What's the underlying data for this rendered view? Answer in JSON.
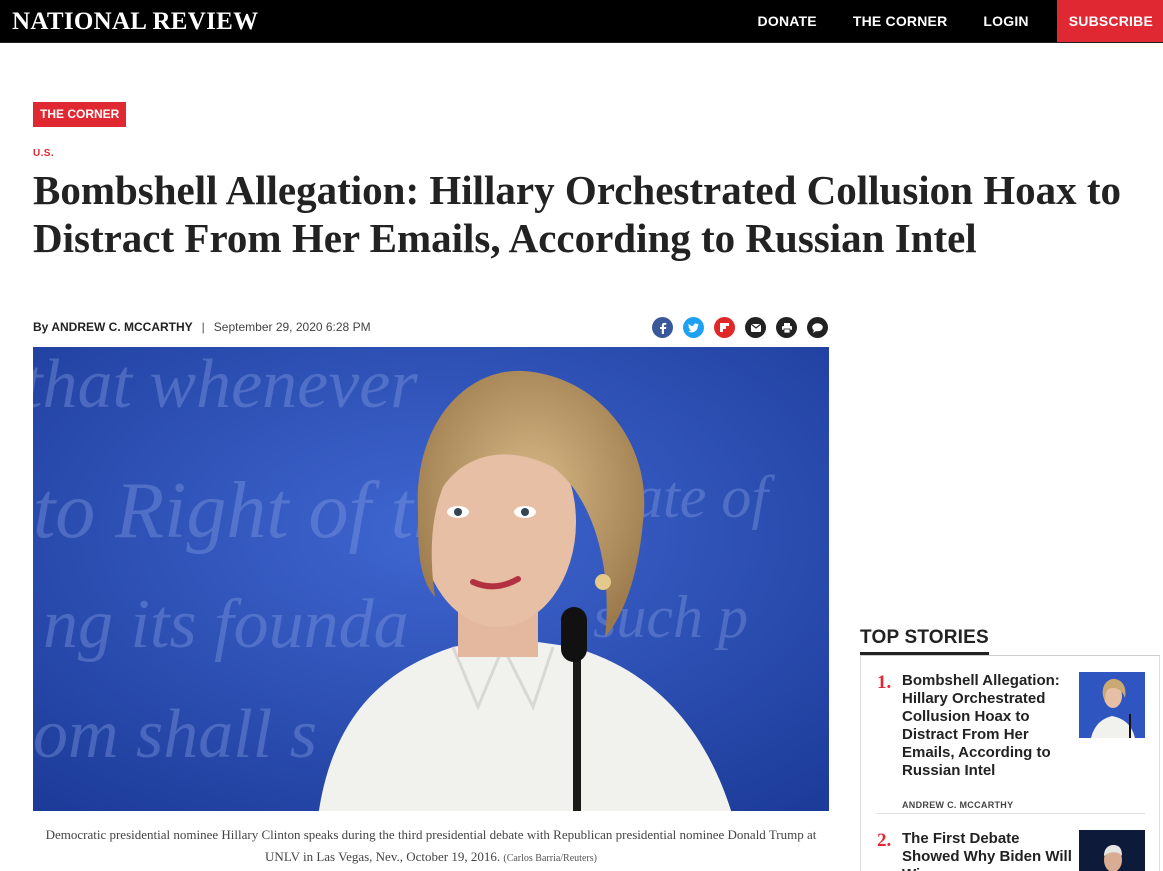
{
  "header": {
    "logo": "NATIONAL REVIEW",
    "nav": {
      "donate": "DONATE",
      "corner": "THE CORNER",
      "login": "LOGIN",
      "subscribe": "SUBSCRIBE"
    }
  },
  "article": {
    "section_tag": "THE CORNER",
    "kicker": "U.S.",
    "headline": "Bombshell Allegation: Hillary Orchestrated Collusion Hoax to Distract From Her Emails, According to Russian Intel",
    "by": "By",
    "author": "ANDREW C. MCCARTHY",
    "separator": "|",
    "date": "September 29, 2020 6:28 PM",
    "share_icons": [
      "facebook-icon",
      "twitter-icon",
      "flipboard-icon",
      "email-icon",
      "print-icon",
      "comment-icon"
    ],
    "caption": "Democratic presidential nominee Hillary Clinton speaks during the third presidential debate with Republican presidential nominee Donald Trump at UNLV in Las Vegas, Nev., October 19, 2016.",
    "credit": "(Carlos Barria/Reuters)"
  },
  "top_stories": {
    "title": "TOP STORIES",
    "items": [
      {
        "num": "1.",
        "title": "Bombshell Allegation: Hillary Orchestrated Collusion Hoax to Distract From Her Emails, According to Russian Intel",
        "author": "ANDREW C. MCCARTHY"
      },
      {
        "num": "2.",
        "title": "The First Debate Showed Why Biden Will Win",
        "author": ""
      }
    ]
  },
  "colors": {
    "brand_red": "#e02833",
    "nav_bg": "#000000",
    "facebook": "#3b5998",
    "twitter": "#1da1f2"
  }
}
